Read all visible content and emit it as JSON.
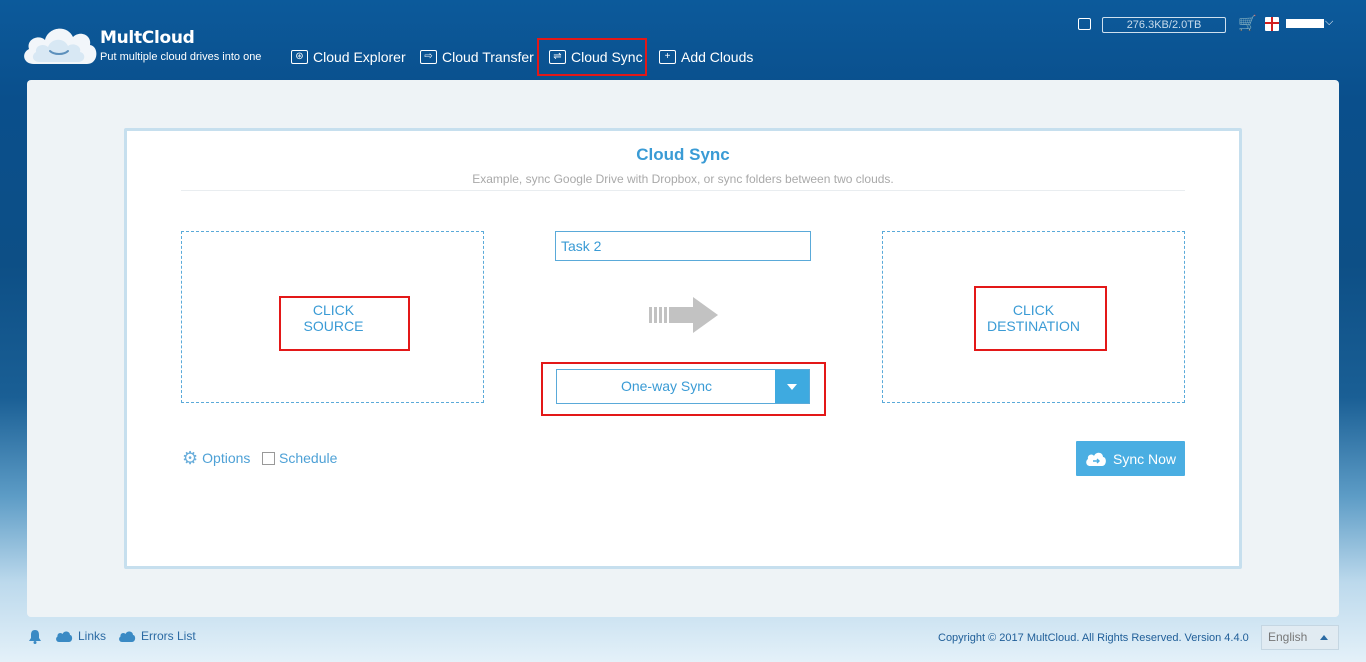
{
  "brand": {
    "name": "MultCloud",
    "tagline": "Put multiple cloud drives into one"
  },
  "nav": [
    {
      "label": "Cloud Explorer",
      "icon": "cloud-explorer-icon"
    },
    {
      "label": "Cloud Transfer",
      "icon": "transfer-icon"
    },
    {
      "label": "Cloud Sync",
      "icon": "sync-icon"
    },
    {
      "label": "Add Clouds",
      "icon": "add-icon"
    }
  ],
  "header": {
    "usage": "276.3KB/2.0TB"
  },
  "sync": {
    "title": "Cloud Sync",
    "subtitle": "Example, sync Google Drive with Dropbox, or sync folders between two clouds.",
    "source_line1": "CLICK",
    "source_line2": "SOURCE",
    "dest_line1": "CLICK",
    "dest_line2": "DESTINATION",
    "task_name": "Task 2",
    "mode": "One-way Sync",
    "options_label": "Options",
    "schedule_label": "Schedule",
    "sync_now_label": "Sync Now"
  },
  "footer": {
    "links_label": "Links",
    "errors_label": "Errors List",
    "copyright": "Copyright © 2017 MultCloud. All Rights Reserved. Version 4.4.0",
    "language": "English"
  },
  "colors": {
    "accent": "#3a9bd5",
    "highlight": "#e31818",
    "button": "#4aaee2"
  }
}
